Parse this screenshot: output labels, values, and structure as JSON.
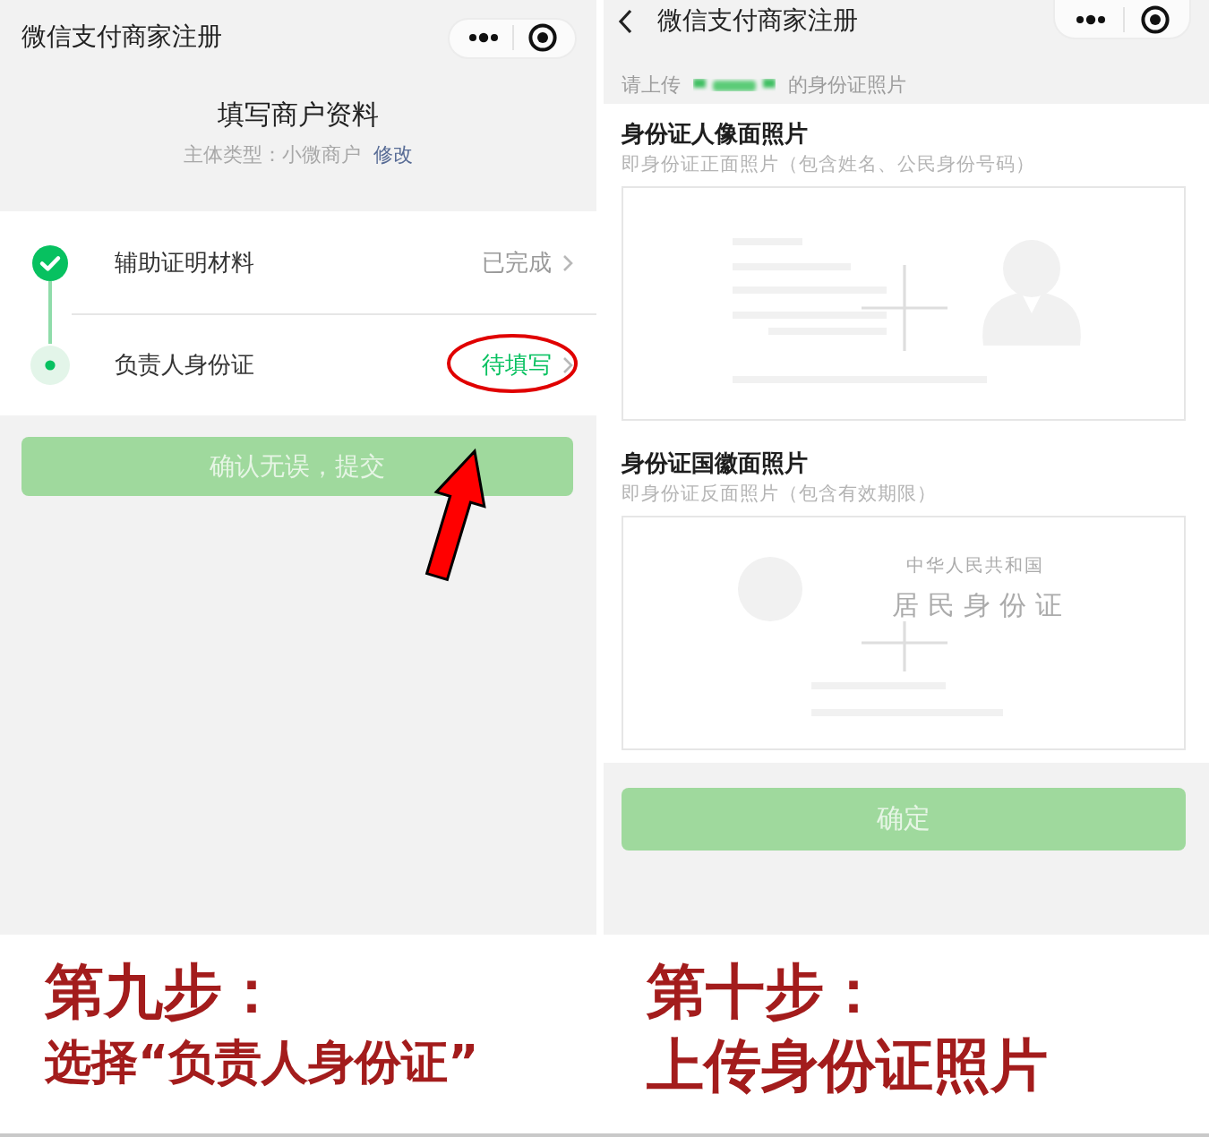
{
  "left_screen": {
    "nav_bar": {
      "title": "微信支付商家注册"
    },
    "header": {
      "title": "填写商户资料",
      "subject_type": "主体类型：小微商户",
      "edit_link": "修改"
    },
    "steps": [
      {
        "label": "辅助证明材料",
        "status": "已完成",
        "kind": "done",
        "annotated": false
      },
      {
        "label": "负责人身份证",
        "status": "待填写",
        "kind": "pending",
        "annotated": true
      }
    ],
    "submit_button": {
      "label": "确认无误，提交",
      "disabled": true
    }
  },
  "right_screen": {
    "nav_bar": {
      "title": "微信支付商家注册"
    },
    "hint": {
      "before": "请上传",
      "after": "的身份证照片"
    },
    "sections": [
      {
        "title": "身份证人像面照片",
        "description": "即身份证正面照片（包含姓名、公民身份号码）",
        "kind": "portrait"
      },
      {
        "title": "身份证国徽面照片",
        "description": "即身份证反面照片（包含有效期限）",
        "kind": "emblem",
        "card_lines": [
          "中华人民共和国",
          "居民身份证"
        ]
      }
    ],
    "confirm_button": {
      "label": "确定",
      "disabled": true
    }
  },
  "captions": [
    {
      "step": "第九步：",
      "text": "选择“负责人身份证”"
    },
    {
      "step": "第十步：",
      "text": "上传身份证照片"
    }
  ]
}
